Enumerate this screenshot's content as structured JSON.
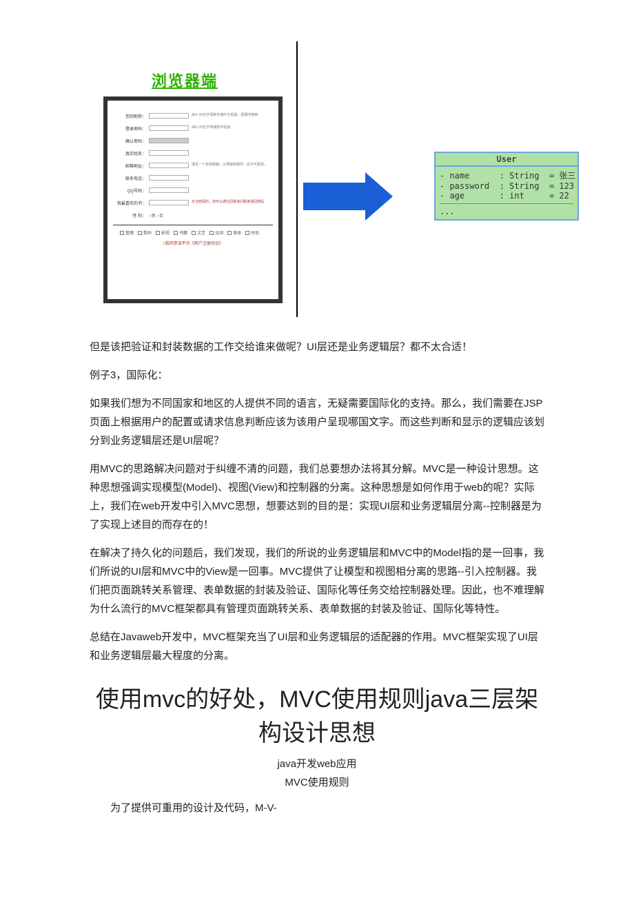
{
  "diagram": {
    "browser_label": "浏览器端",
    "form": {
      "rows": [
        {
          "label": "您的昵称：",
          "hint": "由4~20位字母数字或中文组成，登录时使用"
        },
        {
          "label": "登录密码：",
          "hint": "由6~20位字母或数字组成"
        },
        {
          "label": "确认密码：",
          "shaded": true,
          "hint": ""
        },
        {
          "label": "真实姓名：",
          "hint": ""
        },
        {
          "label": "邮箱地址：",
          "hint": "填写一个有效邮箱，以便接收邮件，后不可更改。"
        },
        {
          "label": "联系电话：",
          "hint": ""
        },
        {
          "label": "QQ号码：",
          "hint": ""
        },
        {
          "label": "我最喜欢的书：",
          "hint": "忘记密码时，您可以通过回答该问题来找回密码",
          "red": true
        }
      ],
      "gender_label": "性 别：",
      "gender_options": [
        "男",
        "女"
      ],
      "check_options": [
        "管理",
        "数码",
        "影视",
        "书籍",
        "文艺",
        "运动",
        "美食",
        "时尚"
      ],
      "submit_note": "□我同意该平台《用户注册协议》"
    },
    "user_box": {
      "title": "User",
      "lines": [
        "- name      : String  = 张三",
        "- password  : String  = 123",
        "- age       : int     = 22",
        "..."
      ]
    }
  },
  "paragraphs": {
    "p1": "但是该把验证和封装数据的工作交给谁来做呢？UI层还是业务逻辑层？都不太合适！",
    "p2": "例子3，国际化：",
    "p3": "如果我们想为不同国家和地区的人提供不同的语言，无疑需要国际化的支持。那么，我们需要在JSP页面上根据用户的配置或请求信息判断应该为该用户呈现哪国文字。而这些判断和显示的逻辑应该划分到业务逻辑层还是UI层呢？",
    "p4": "用MVC的思路解决问题对于纠缠不清的问题，我们总要想办法将其分解。MVC是一种设计思想。这种思想强调实现模型(Model)、视图(View)和控制器的分离。这种思想是如何作用于web的呢？实际上，我们在web开发中引入MVC思想，想要达到的目的是：实现UI层和业务逻辑层分离--控制器是为了实现上述目的而存在的！",
    "p5": "在解决了持久化的问题后，我们发现，我们的所说的业务逻辑层和MVC中的Model指的是一回事，我们所说的UI层和MVC中的View是一回事。MVC提供了让模型和视图相分离的思路--引入控制器。我们把页面跳转关系管理、表单数据的封装及验证、国际化等任务交给控制器处理。因此，也不难理解为什么流行的MVC框架都具有管理页面跳转关系、表单数据的封装及验证、国际化等特性。",
    "p6": "总结在Javaweb开发中，MVC框架充当了UI层和业务逻辑层的适配器的作用。MVC框架实现了UI层和业务逻辑层最大程度的分离。"
  },
  "title": "使用mvc的好处，MVC使用规则java三层架构设计思想",
  "center": {
    "c1": "java开发web应用",
    "c2": "MVC使用规则"
  },
  "last_indent": "为了提供可重用的设计及代码，M-V-"
}
